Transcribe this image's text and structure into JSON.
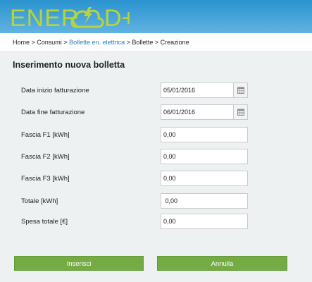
{
  "brand": {
    "logo_text_left": "ENER",
    "logo_text_right": "D+",
    "header_color": "#2b93cf",
    "logo_color": "#b8d43a"
  },
  "breadcrumb": {
    "home": "Home",
    "sep1": " > ",
    "consumi": "Consumi",
    "sep2": " > ",
    "bollette": "Bollette en. elettrica",
    "sep3": " > ",
    "bollette2": "Bollette",
    "sep4": " > ",
    "creazione": "Creazione"
  },
  "form": {
    "title": "Inserimento nuova bolletta",
    "fields": [
      {
        "label": "Data inizio fatturazione",
        "value": "05/01/2016"
      },
      {
        "label": "Data fine fatturazione",
        "value": "06/01/2016"
      },
      {
        "label": "Fascia F1 [kWh]",
        "value": "0,00"
      },
      {
        "label": "Fascia F2 [kWh]",
        "value": "0,00"
      },
      {
        "label": "Fascia F3 [kWh]",
        "value": "0,00"
      },
      {
        "label": "Totale [kWh]",
        "value": " 0,00"
      },
      {
        "label": "Spesa totale [€]",
        "value": "0,00"
      }
    ],
    "submit_label": "Inserisci",
    "cancel_label": "Annulla",
    "button_color": "#74ab45"
  },
  "icons": {
    "calendar": "calendar-icon"
  }
}
